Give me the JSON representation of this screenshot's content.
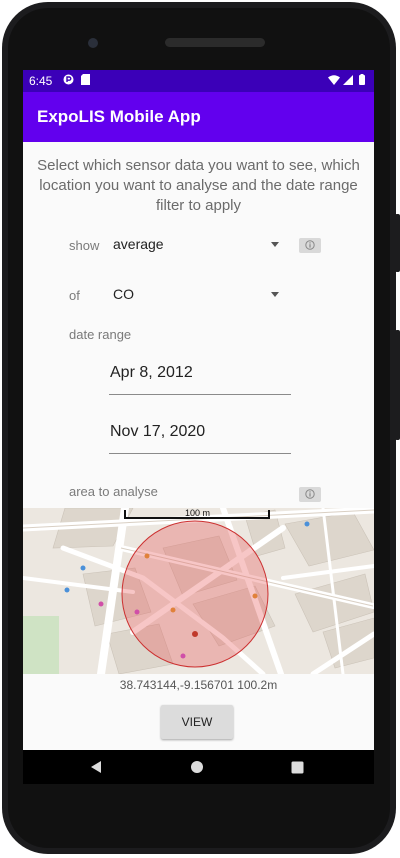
{
  "status_bar": {
    "time": "6:45"
  },
  "app_bar": {
    "title": "ExpoLIS Mobile App"
  },
  "instructions": "Select which sensor data you want to see, which location you want to analyse and the date range filter to apply",
  "show": {
    "label": "show",
    "selected": "average"
  },
  "of": {
    "label": "of",
    "selected": "CO"
  },
  "date_range": {
    "label": "date range",
    "start": "Apr 8, 2012",
    "end": "Nov 17, 2020"
  },
  "area": {
    "label": "area to analyse"
  },
  "map": {
    "scale_label": "100 m",
    "radius_m": 100.2
  },
  "coordinates": "38.743144,-9.156701 100.2m",
  "view_button": {
    "label": "VIEW"
  }
}
